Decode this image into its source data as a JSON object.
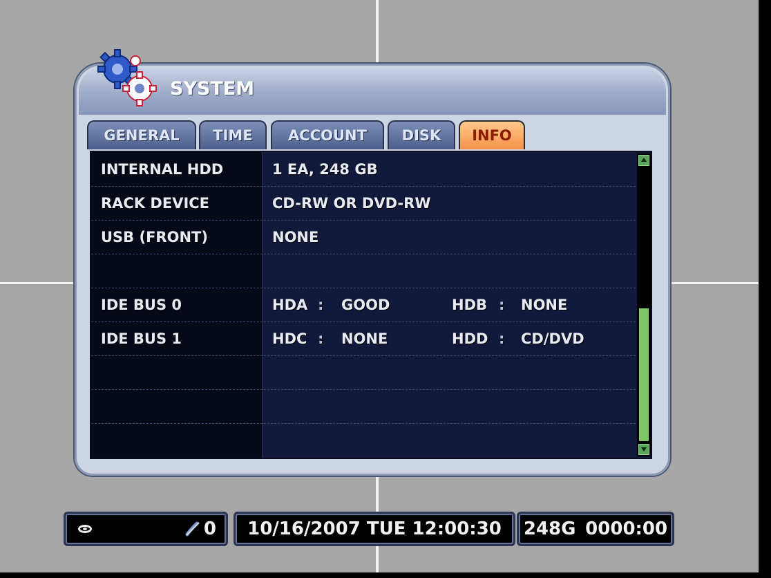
{
  "window": {
    "title": "SYSTEM"
  },
  "tabs": [
    {
      "label": "GENERAL",
      "active": false
    },
    {
      "label": "TIME",
      "active": false
    },
    {
      "label": "ACCOUNT",
      "active": false
    },
    {
      "label": "DISK",
      "active": false
    },
    {
      "label": "INFO",
      "active": true
    }
  ],
  "info_table": {
    "rows": [
      {
        "label": "INTERNAL HDD",
        "value": "1 EA, 248 GB"
      },
      {
        "label": "RACK DEVICE",
        "value": "CD-RW OR DVD-RW"
      },
      {
        "label": "USB (FRONT)",
        "value": "NONE"
      },
      {
        "label": "",
        "value": ""
      },
      {
        "label": "IDE BUS 0",
        "a_name": "HDA",
        "a_sep": ":",
        "a_value": "GOOD",
        "b_name": "HDB",
        "b_sep": ":",
        "b_value": "NONE"
      },
      {
        "label": "IDE BUS 1",
        "a_name": "HDC",
        "a_sep": ":",
        "a_value": "NONE",
        "b_name": "HDD",
        "b_sep": ":",
        "b_value": "CD/DVD"
      },
      {
        "label": "",
        "value": ""
      },
      {
        "label": "",
        "value": ""
      },
      {
        "label": "",
        "value": ""
      }
    ]
  },
  "scrollbar": {
    "thumb_position_fraction": 0.5
  },
  "status_bar": {
    "live_icon": "eye-icon",
    "network_icon": "network-icon",
    "network_count": "0",
    "datetime": "10/16/2007 TUE 12:00:30",
    "disk_capacity": "248G",
    "record_time": "0000:00"
  },
  "colors": {
    "active_tab": "#f3924a",
    "panel_bg": "#121a3b",
    "scroll_thumb": "#7fc86a"
  }
}
